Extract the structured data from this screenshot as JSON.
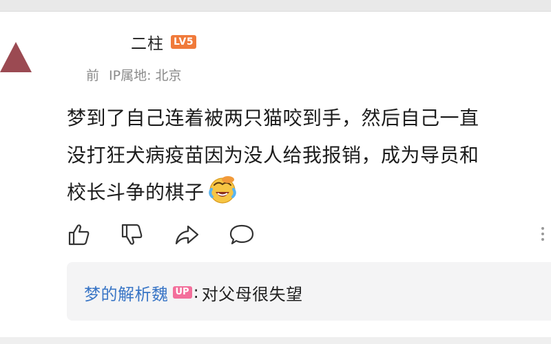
{
  "comment": {
    "username": "二柱",
    "level_badge": "LV5",
    "time": "前",
    "ip_location": "IP属地: 北京",
    "lines": [
      "梦到了自己连着被两只猫咬到手，然后自己一直",
      "没打狂犬病疫苗因为没人给我报销，成为导员和",
      "校长斗争的棋子"
    ],
    "inline_emoji": "laughing-crying-emoji"
  },
  "actions": {
    "icons": [
      "thumbs-up-icon",
      "thumbs-down-icon",
      "share-icon",
      "comment-icon",
      "more-icon"
    ]
  },
  "reply": {
    "author": "梦的解析魏",
    "badge": "UP",
    "colon": ":",
    "text": "对父母很失望"
  },
  "colors": {
    "level_badge": "#f07a3a",
    "up_badge": "#f36f9b",
    "reply_author": "#3a76c6",
    "avatar_shape": "#9b4a52"
  }
}
